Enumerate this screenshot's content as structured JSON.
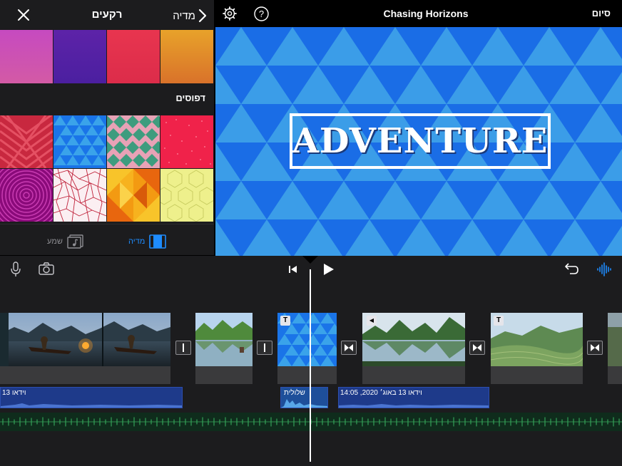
{
  "browser": {
    "title": "רקעים",
    "back_label": "מדיה",
    "section_title": "דפוסים",
    "tabs": [
      {
        "label": "מדיה",
        "icon": "film-icon",
        "selected": true
      },
      {
        "label": "שמע",
        "icon": "music-note-icon",
        "selected": false
      }
    ],
    "colors": {
      "swatches": [
        "#cc4fb8",
        "#5a21a8",
        "#e83550",
        "#e6962a"
      ],
      "accent": "#1e8cff"
    },
    "patterns": [
      {
        "name": "red-chevron-pattern"
      },
      {
        "name": "blue-triangle-pattern"
      },
      {
        "name": "pink-green-diamond-pattern"
      },
      {
        "name": "red-dots-pattern"
      },
      {
        "name": "magenta-circles-pattern"
      },
      {
        "name": "red-line-mesh-pattern"
      },
      {
        "name": "orange-geometric-pattern"
      },
      {
        "name": "yellow-hexagon-pattern"
      }
    ]
  },
  "viewer": {
    "project_title": "Chasing Horizons",
    "done_label": "סיום",
    "title_text": "ADVENTURE"
  },
  "timeline": {
    "audio_clips": [
      {
        "label": "וידאו 13"
      },
      {
        "label": "שלולית"
      },
      {
        "label": "וידאו 13 באוג׳ 2020, 14:05"
      }
    ]
  }
}
